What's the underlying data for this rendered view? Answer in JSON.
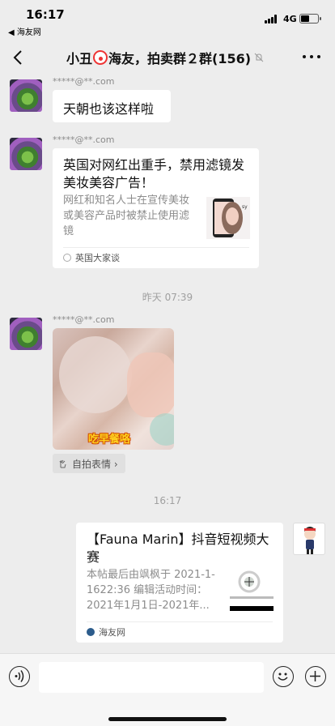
{
  "status_bar": {
    "time": "16:17",
    "back_app": "◀ 海友网",
    "network": "4G",
    "battery_level": 0.5
  },
  "nav": {
    "title_prefix": "小丑",
    "title_suffix": "海友，拍卖群２群(156)"
  },
  "messages": [
    {
      "sender": "*****@**.com",
      "text": "天朝也该这样啦"
    },
    {
      "sender": "*****@**.com",
      "article": {
        "title": "英国对网红出重手，禁用滤镜发美妆美容广告！",
        "desc": "网红和知名人士在宣传美妆或美容产品时被禁止使用滤镜",
        "source": "英国大家谈"
      }
    },
    {
      "timestamp": "昨天 07:39"
    },
    {
      "sender": "*****@**.com",
      "photo_caption": "吃早餐咯",
      "sticker_tag": "自拍表情 ›"
    },
    {
      "timestamp": "16:17"
    },
    {
      "article": {
        "title": "【Fauna Marin】抖音短视频大赛",
        "desc": "本帖最后由飒枫于 2021-1-1622:36 编辑活动时间：2021年1月1日-2021年...",
        "source": "海友网"
      }
    }
  ],
  "colors": {
    "background": "#ededed",
    "bubble": "#ffffff",
    "timestamp": "#a0a0a0"
  }
}
